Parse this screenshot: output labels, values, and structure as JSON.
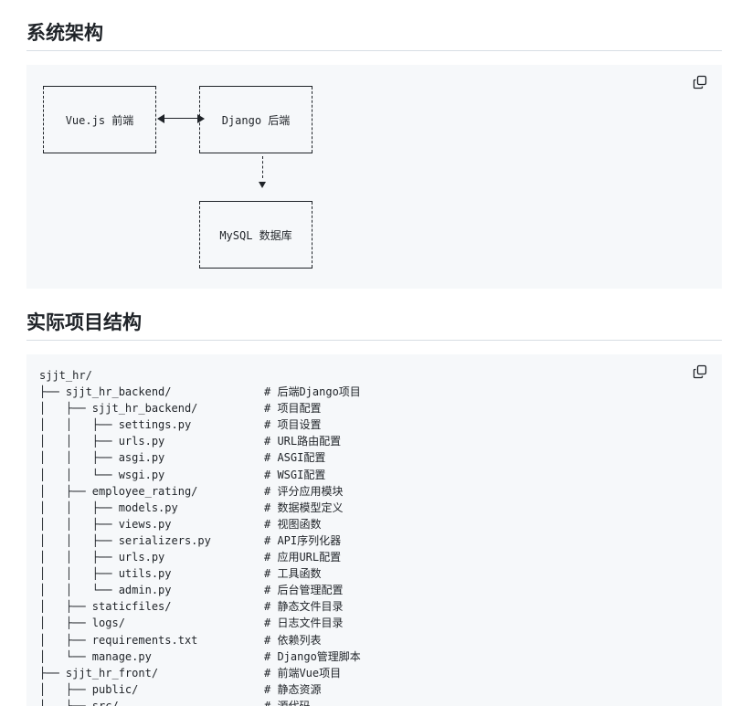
{
  "sections": {
    "architecture": {
      "title": "系统架构",
      "diagram": {
        "frontend_label": "Vue.js 前端",
        "backend_label": "Django 后端",
        "database_label": "MySQL 数据库"
      }
    },
    "structure": {
      "title": "实际项目结构",
      "tree": [
        [
          "sjjt_hr/",
          ""
        ],
        [
          "├── sjjt_hr_backend/",
          "# 后端Django项目"
        ],
        [
          "│   ├── sjjt_hr_backend/",
          "# 项目配置"
        ],
        [
          "│   │   ├── settings.py",
          "# 项目设置"
        ],
        [
          "│   │   ├── urls.py",
          "# URL路由配置"
        ],
        [
          "│   │   ├── asgi.py",
          "# ASGI配置"
        ],
        [
          "│   │   └── wsgi.py",
          "# WSGI配置"
        ],
        [
          "│   ├── employee_rating/",
          "# 评分应用模块"
        ],
        [
          "│   │   ├── models.py",
          "# 数据模型定义"
        ],
        [
          "│   │   ├── views.py",
          "# 视图函数"
        ],
        [
          "│   │   ├── serializers.py",
          "# API序列化器"
        ],
        [
          "│   │   ├── urls.py",
          "# 应用URL配置"
        ],
        [
          "│   │   ├── utils.py",
          "# 工具函数"
        ],
        [
          "│   │   └── admin.py",
          "# 后台管理配置"
        ],
        [
          "│   ├── staticfiles/",
          "# 静态文件目录"
        ],
        [
          "│   ├── logs/",
          "# 日志文件目录"
        ],
        [
          "│   ├── requirements.txt",
          "# 依赖列表"
        ],
        [
          "│   └── manage.py",
          "# Django管理脚本"
        ],
        [
          "├── sjjt_hr_front/",
          "# 前端Vue项目"
        ],
        [
          "│   ├── public/",
          "# 静态资源"
        ],
        [
          "│   ├── src/",
          "# 源代码"
        ]
      ]
    }
  },
  "icons": {
    "copy": "copy-icon"
  },
  "colors": {
    "code_background": "#f6f8fa",
    "text": "#1f2328",
    "rule": "#d8dee4"
  }
}
